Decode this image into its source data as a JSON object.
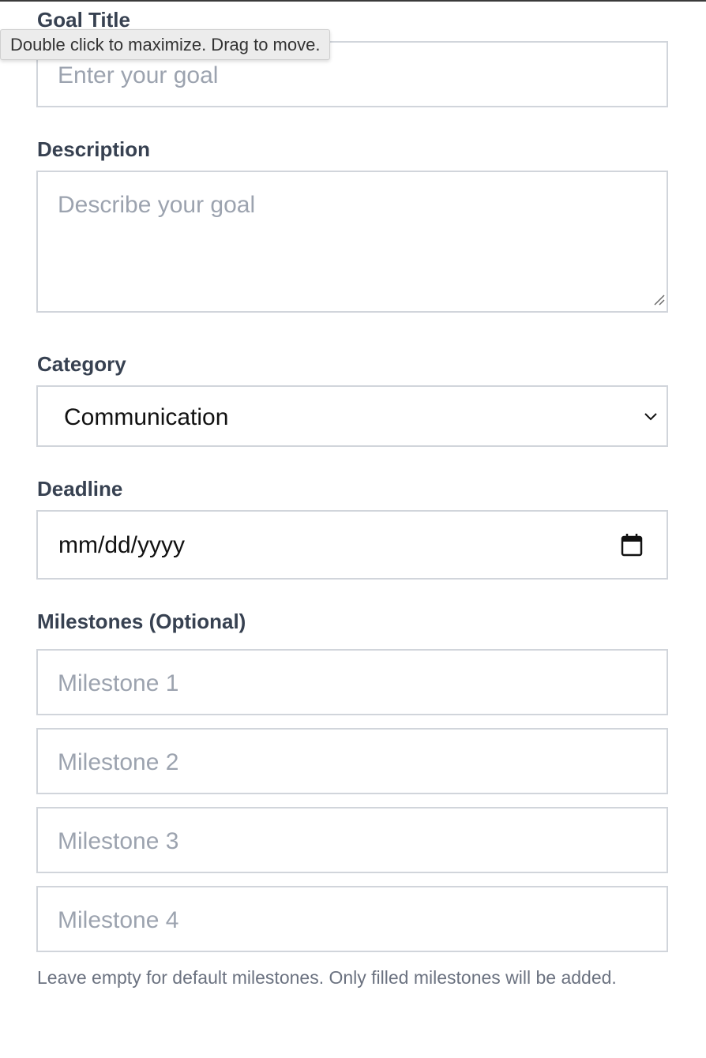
{
  "form": {
    "goal_title": {
      "label": "Goal Title",
      "placeholder": "Enter your goal",
      "value": ""
    },
    "description": {
      "label": "Description",
      "placeholder": "Describe your goal",
      "value": ""
    },
    "category": {
      "label": "Category",
      "selected": "Communication"
    },
    "deadline": {
      "label": "Deadline",
      "value": "mm/dd/yyyy"
    },
    "milestones": {
      "label": "Milestones (Optional)",
      "items": [
        {
          "placeholder": "Milestone 1",
          "value": ""
        },
        {
          "placeholder": "Milestone 2",
          "value": ""
        },
        {
          "placeholder": "Milestone 3",
          "value": ""
        },
        {
          "placeholder": "Milestone 4",
          "value": ""
        }
      ],
      "helper_text": "Leave empty for default milestones. Only filled milestones will be added."
    }
  },
  "tooltip": {
    "text": "Double click to maximize. Drag to move."
  },
  "icons": {
    "select_arrow": "chevron-down-icon",
    "date_picker": "calendar-icon",
    "textarea_resize": "resize-handle-icon"
  },
  "colors": {
    "label_text": "#374151",
    "placeholder_text": "#9ca3af",
    "field_border": "#d1d5db",
    "helper_text": "#6b7280",
    "value_text": "#111111"
  }
}
